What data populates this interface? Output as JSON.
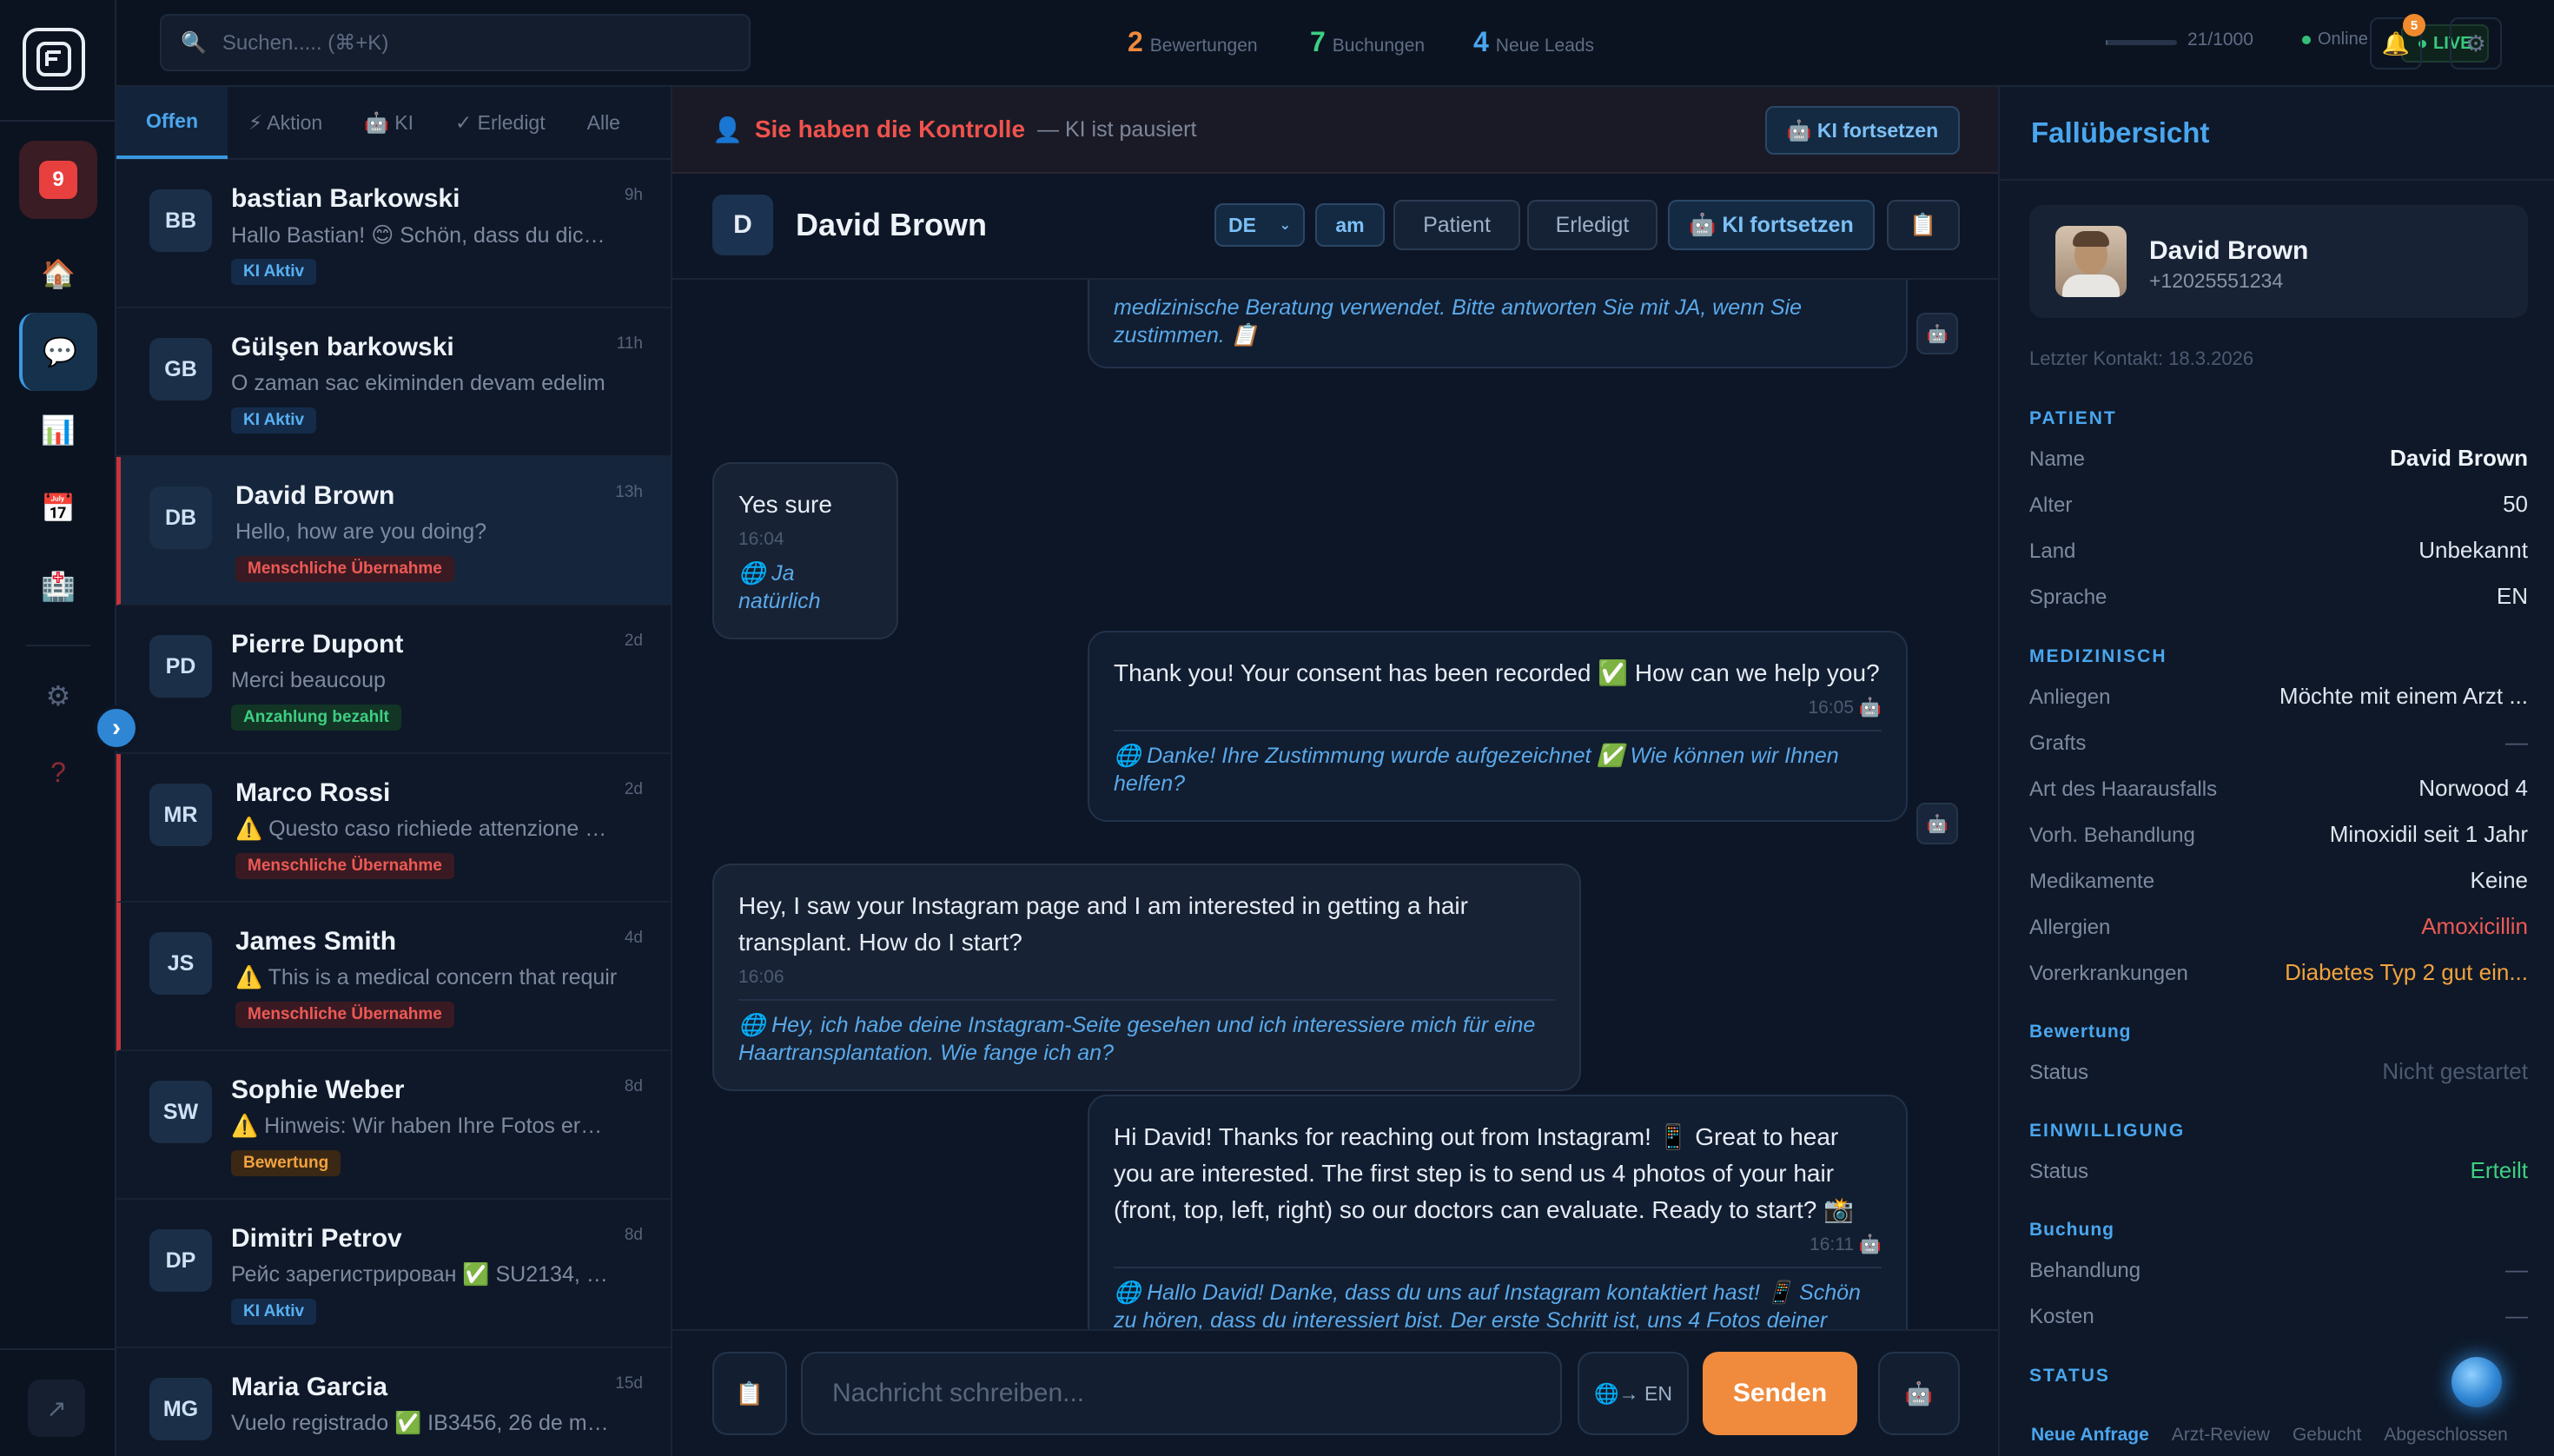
{
  "app": {
    "notification_badge": "9"
  },
  "search": {
    "placeholder": "Suchen..... (⌘+K)"
  },
  "stats": [
    {
      "value": "2",
      "label": "Bewertungen",
      "color": "#f08a3c"
    },
    {
      "value": "7",
      "label": "Buchungen",
      "color": "#3ecf82"
    },
    {
      "value": "4",
      "label": "Neue Leads",
      "color": "#4aa6ee"
    }
  ],
  "usage": {
    "text": "21/1000",
    "fraction": 0.021
  },
  "status": {
    "online": "Online",
    "live": "LIVE",
    "notifications": "5"
  },
  "tabs": [
    "Offen",
    "⚡ Aktion",
    "🤖 KI",
    "✓ Erledigt",
    "Alle"
  ],
  "conversations": [
    {
      "initials": "BB",
      "name": "bastian Barkowski",
      "time": "9h",
      "message": "Hallo Bastian! 😊 Schön, dass du dich m",
      "tag": "KI Aktiv"
    },
    {
      "initials": "GB",
      "name": "Gülşen barkowski",
      "time": "11h",
      "message": "O zaman sac ekiminden devam edelim",
      "tag": "KI Aktiv"
    },
    {
      "initials": "DB",
      "name": "David Brown",
      "time": "13h",
      "message": "Hello, how are you doing?",
      "tag": "Menschliche Übernahme"
    },
    {
      "initials": "PD",
      "name": "Pierre Dupont",
      "time": "2d",
      "message": "Merci beaucoup",
      "tag": "Anzahlung bezahlt"
    },
    {
      "initials": "MR",
      "name": "Marco Rossi",
      "time": "2d",
      "message": "⚠️ Questo caso richiede attenzione perso",
      "tag": "Menschliche Übernahme"
    },
    {
      "initials": "JS",
      "name": "James Smith",
      "time": "4d",
      "message": "⚠️ This is a medical concern that requir",
      "tag": "Menschliche Übernahme"
    },
    {
      "initials": "SW",
      "name": "Sophie Weber",
      "time": "8d",
      "message": "⚠️ Hinweis: Wir haben Ihre Fotos erhalte",
      "tag": "Bewertung"
    },
    {
      "initials": "DP",
      "name": "Dimitri Petrov",
      "time": "8d",
      "message": "Рейс зарегистрирован ✅ SU2134, 25 м...",
      "tag": "KI Aktiv"
    },
    {
      "initials": "MG",
      "name": "Maria Garcia",
      "time": "15d",
      "message": "Vuelo registrado ✅ IB3456, 26 de marzo.",
      "tag": ""
    }
  ],
  "control": {
    "title": "Sie haben die Kontrolle",
    "subtitle": "— KI ist pausiert",
    "resume": "🤖 KI fortsetzen"
  },
  "chat": {
    "initial": "D",
    "name": "David Brown",
    "language": "DE",
    "buttons": {
      "am": "am",
      "patient": "Patient",
      "done": "Erledigt",
      "resume": "🤖 KI fortsetzen",
      "notes": "📋"
    }
  },
  "messages": {
    "m0": {
      "translation": "medizinische Beratung verwendet. Bitte antworten Sie mit JA, wenn Sie zustimmen. 📋"
    },
    "m1": {
      "text": "Yes sure",
      "time": "16:04",
      "translation": "🌐 Ja natürlich"
    },
    "m2": {
      "text": "Thank you! Your consent has been recorded ✅ How can we help you?",
      "time": "16:05 🤖",
      "translation": "🌐 Danke! Ihre Zustimmung wurde aufgezeichnet ✅ Wie können wir Ihnen helfen?"
    },
    "m3": {
      "text": "Hey, I saw your Instagram page and I am interested in getting a hair transplant. How do I start?",
      "time": "16:06",
      "translation": "🌐 Hey, ich habe deine Instagram-Seite gesehen und ich interessiere mich für eine Haartransplantation. Wie fange ich an?"
    },
    "m4": {
      "text": "Hi David! Thanks for reaching out from Instagram! 📱 Great to hear you are interested. The first step is to send us 4 photos of your hair (front, top, left, right) so our doctors can evaluate. Ready to start? 📸",
      "time": "16:11 🤖",
      "translation": "🌐 Hallo David! Danke, dass du uns auf Instagram kontaktiert hast! 📱 Schön zu hören, dass du interessiert bist. Der erste Schritt ist, uns 4 Fotos deiner Haare zu schicken (vorne, oben, links, rechts), damit unsere Ärzte diese bewerten können. Bereit, anzufangen? 📸"
    }
  },
  "composer": {
    "placeholder": "Nachricht schreiben...",
    "translate": "🌐→ EN",
    "send": "Senden",
    "template": "📋",
    "robot": "🤖"
  },
  "panel": {
    "title": "Fallübersicht",
    "name": "David Brown",
    "phone": "+12025551234",
    "last_contact": "Letzter Kontakt: 18.3.2026",
    "sections": {
      "patient": "PATIENT",
      "medical": "MEDIZINISCH",
      "rating": "Bewertung",
      "consent": "EINWILLIGUNG",
      "booking": "Buchung",
      "status": "STATUS"
    },
    "fields": {
      "name": {
        "k": "Name",
        "v": "David Brown"
      },
      "age": {
        "k": "Alter",
        "v": "50"
      },
      "country": {
        "k": "Land",
        "v": "Unbekannt"
      },
      "language": {
        "k": "Sprache",
        "v": "EN"
      },
      "concern": {
        "k": "Anliegen",
        "v": "Möchte mit einem Arzt ..."
      },
      "grafts": {
        "k": "Grafts",
        "v": "—"
      },
      "hairloss": {
        "k": "Art des Haarausfalls",
        "v": "Norwood 4"
      },
      "prev": {
        "k": "Vorh. Behandlung",
        "v": "Minoxidil seit 1 Jahr"
      },
      "meds": {
        "k": "Medikamente",
        "v": "Keine"
      },
      "allergies": {
        "k": "Allergien",
        "v": "Amoxicillin"
      },
      "conditions": {
        "k": "Vorerkrankungen",
        "v": "Diabetes Typ 2 gut ein..."
      },
      "rating_status": {
        "k": "Status",
        "v": "Nicht gestartet"
      },
      "consent_status": {
        "k": "Status",
        "v": "Erteilt"
      },
      "treatment": {
        "k": "Behandlung",
        "v": "—"
      },
      "cost": {
        "k": "Kosten",
        "v": "—"
      }
    },
    "stages": [
      "Neue Anfrage",
      "Arzt-Review",
      "Gebucht",
      "Abgeschlossen"
    ]
  }
}
